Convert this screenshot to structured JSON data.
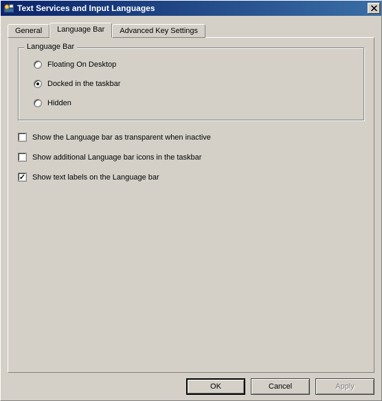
{
  "window": {
    "title": "Text Services and Input Languages"
  },
  "tabs": {
    "general": "General",
    "language_bar": "Language Bar",
    "advanced": "Advanced Key Settings"
  },
  "groupbox": {
    "legend": "Language Bar",
    "options": {
      "floating": "Floating On Desktop",
      "docked": "Docked in the taskbar",
      "hidden": "Hidden"
    }
  },
  "checkboxes": {
    "transparent": "Show the Language bar as transparent when inactive",
    "additional_icons": "Show additional Language bar icons in the taskbar",
    "text_labels": "Show text labels on the Language bar"
  },
  "buttons": {
    "ok": "OK",
    "cancel": "Cancel",
    "apply": "Apply"
  }
}
